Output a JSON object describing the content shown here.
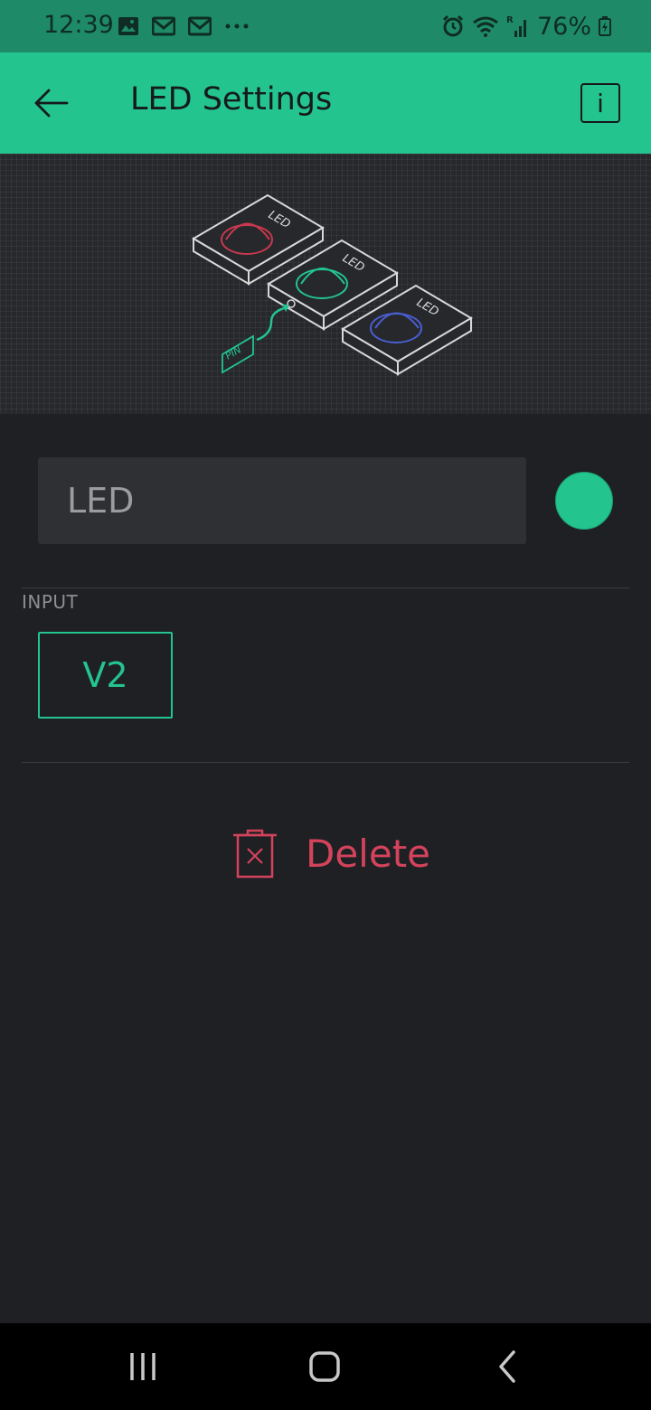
{
  "status_bar": {
    "time": "12:39",
    "battery": "76%",
    "left_icons": [
      "image-icon",
      "gmail-icon",
      "gmail-icon",
      "more-dots-icon"
    ],
    "right_icons": [
      "alarm-icon",
      "wifi-icon",
      "signal-icon",
      "battery-charging-icon"
    ]
  },
  "app_bar": {
    "title": "LED Settings",
    "info_label": "i"
  },
  "hero": {
    "led_label": "LED",
    "pin_label": "PIN"
  },
  "form": {
    "name_value": "LED",
    "color": "#23c48e",
    "input_label": "INPUT",
    "pin_value": "V2",
    "delete_label": "Delete"
  },
  "colors": {
    "accent": "#23c48e",
    "danger": "#d3435c",
    "background": "#1f2024"
  }
}
